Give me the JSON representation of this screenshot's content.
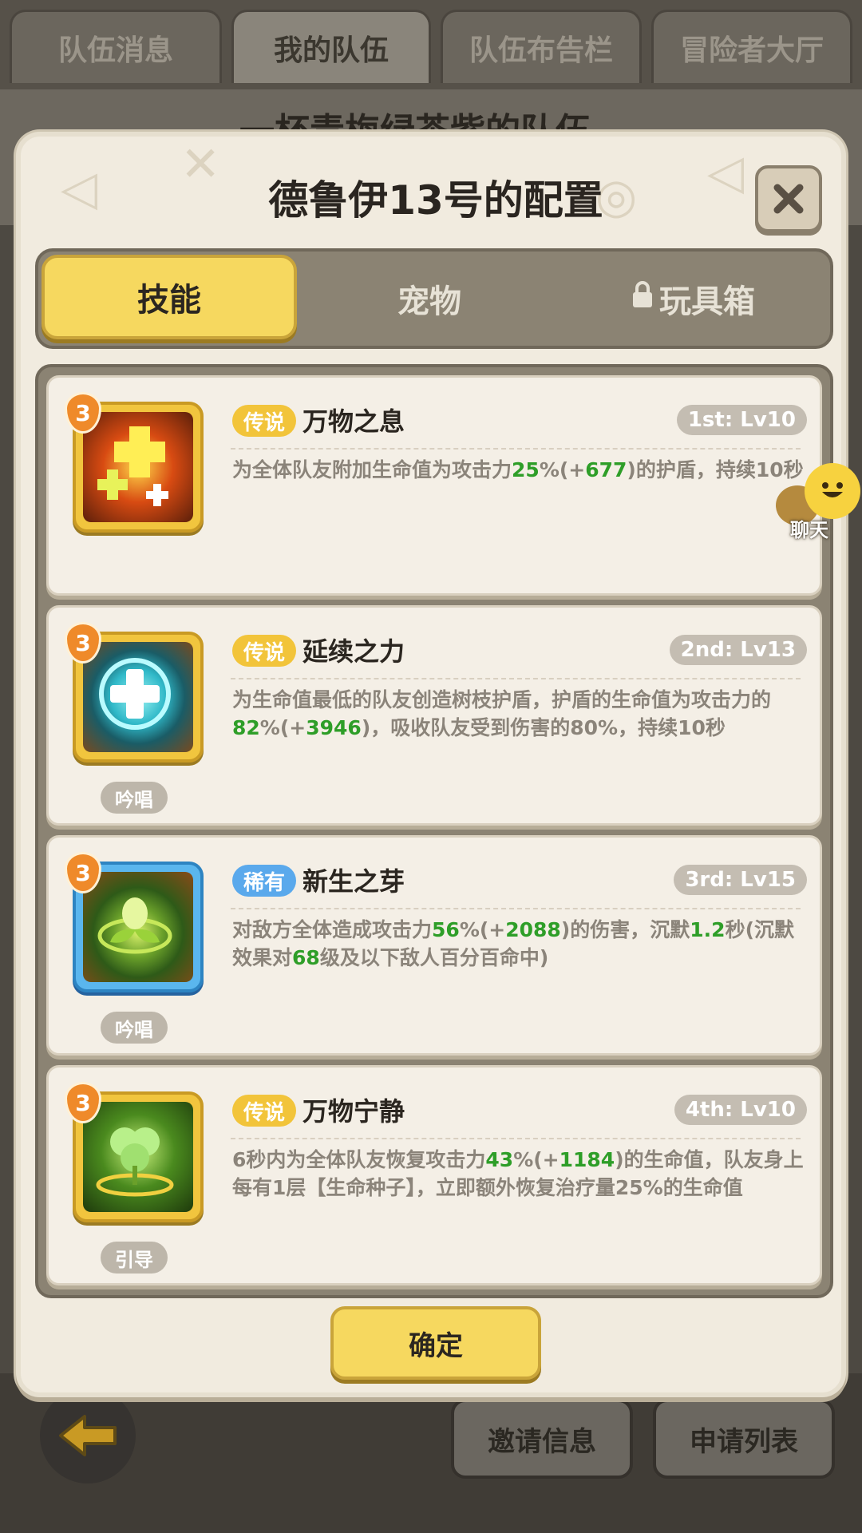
{
  "top_tabs": [
    "队伍消息",
    "我的队伍",
    "队伍布告栏",
    "冒险者大厅"
  ],
  "active_top_tab": 1,
  "background_title": "一杯青梅绿茶紫的队伍",
  "bottom_buttons": {
    "invite": "邀请信息",
    "apply_list": "申请列表"
  },
  "dialog": {
    "title": "德鲁伊13号的配置",
    "tabs": [
      {
        "label": "技能",
        "active": true,
        "locked": false
      },
      {
        "label": "宠物",
        "active": false,
        "locked": false
      },
      {
        "label": "玩具箱",
        "active": false,
        "locked": true
      }
    ],
    "skills": [
      {
        "level_badge": "3",
        "rarity": "传说",
        "rarity_type": "legend",
        "name": "万物之息",
        "slot": "1st: Lv10",
        "cast": "",
        "desc_parts": [
          {
            "t": "为全体队友附加生命值为攻击力"
          },
          {
            "t": "25",
            "g": true
          },
          {
            "t": "%(+"
          },
          {
            "t": "677",
            "g": true
          },
          {
            "t": ")的护盾，持续10秒"
          }
        ]
      },
      {
        "level_badge": "3",
        "rarity": "传说",
        "rarity_type": "legend",
        "name": "延续之力",
        "slot": "2nd: Lv13",
        "cast": "吟唱",
        "desc_parts": [
          {
            "t": "为生命值最低的队友创造树枝护盾，护盾的生命值为攻击力的"
          },
          {
            "t": "82",
            "g": true
          },
          {
            "t": "%(+"
          },
          {
            "t": "3946",
            "g": true
          },
          {
            "t": ")，吸收队友受到伤害的80%，持续10秒"
          }
        ]
      },
      {
        "level_badge": "3",
        "rarity": "稀有",
        "rarity_type": "rare",
        "name": "新生之芽",
        "slot": "3rd: Lv15",
        "cast": "吟唱",
        "desc_parts": [
          {
            "t": "对敌方全体造成攻击力"
          },
          {
            "t": "56",
            "g": true
          },
          {
            "t": "%(+"
          },
          {
            "t": "2088",
            "g": true
          },
          {
            "t": ")的伤害，沉默"
          },
          {
            "t": "1.2",
            "g": true
          },
          {
            "t": "秒(沉默效果对"
          },
          {
            "t": "68",
            "g": true
          },
          {
            "t": "级及以下敌人百分百命中)"
          }
        ]
      },
      {
        "level_badge": "3",
        "rarity": "传说",
        "rarity_type": "legend",
        "name": "万物宁静",
        "slot": "4th: Lv10",
        "cast": "引导",
        "desc_parts": [
          {
            "t": "6秒内为全体队友恢复攻击力"
          },
          {
            "t": "43",
            "g": true
          },
          {
            "t": "%(+"
          },
          {
            "t": "1184",
            "g": true
          },
          {
            "t": ")的生命值，队友身上每有1层【生命种子】，立即额外恢复治疗量25%的生命值"
          }
        ]
      }
    ],
    "confirm_label": "确定"
  },
  "chat": {
    "label": "聊天"
  },
  "colors": {
    "accent_yellow": "#f6d85f",
    "value_green": "#2e9e28",
    "legend": "#f2c43a",
    "rare": "#5aa9ec"
  }
}
